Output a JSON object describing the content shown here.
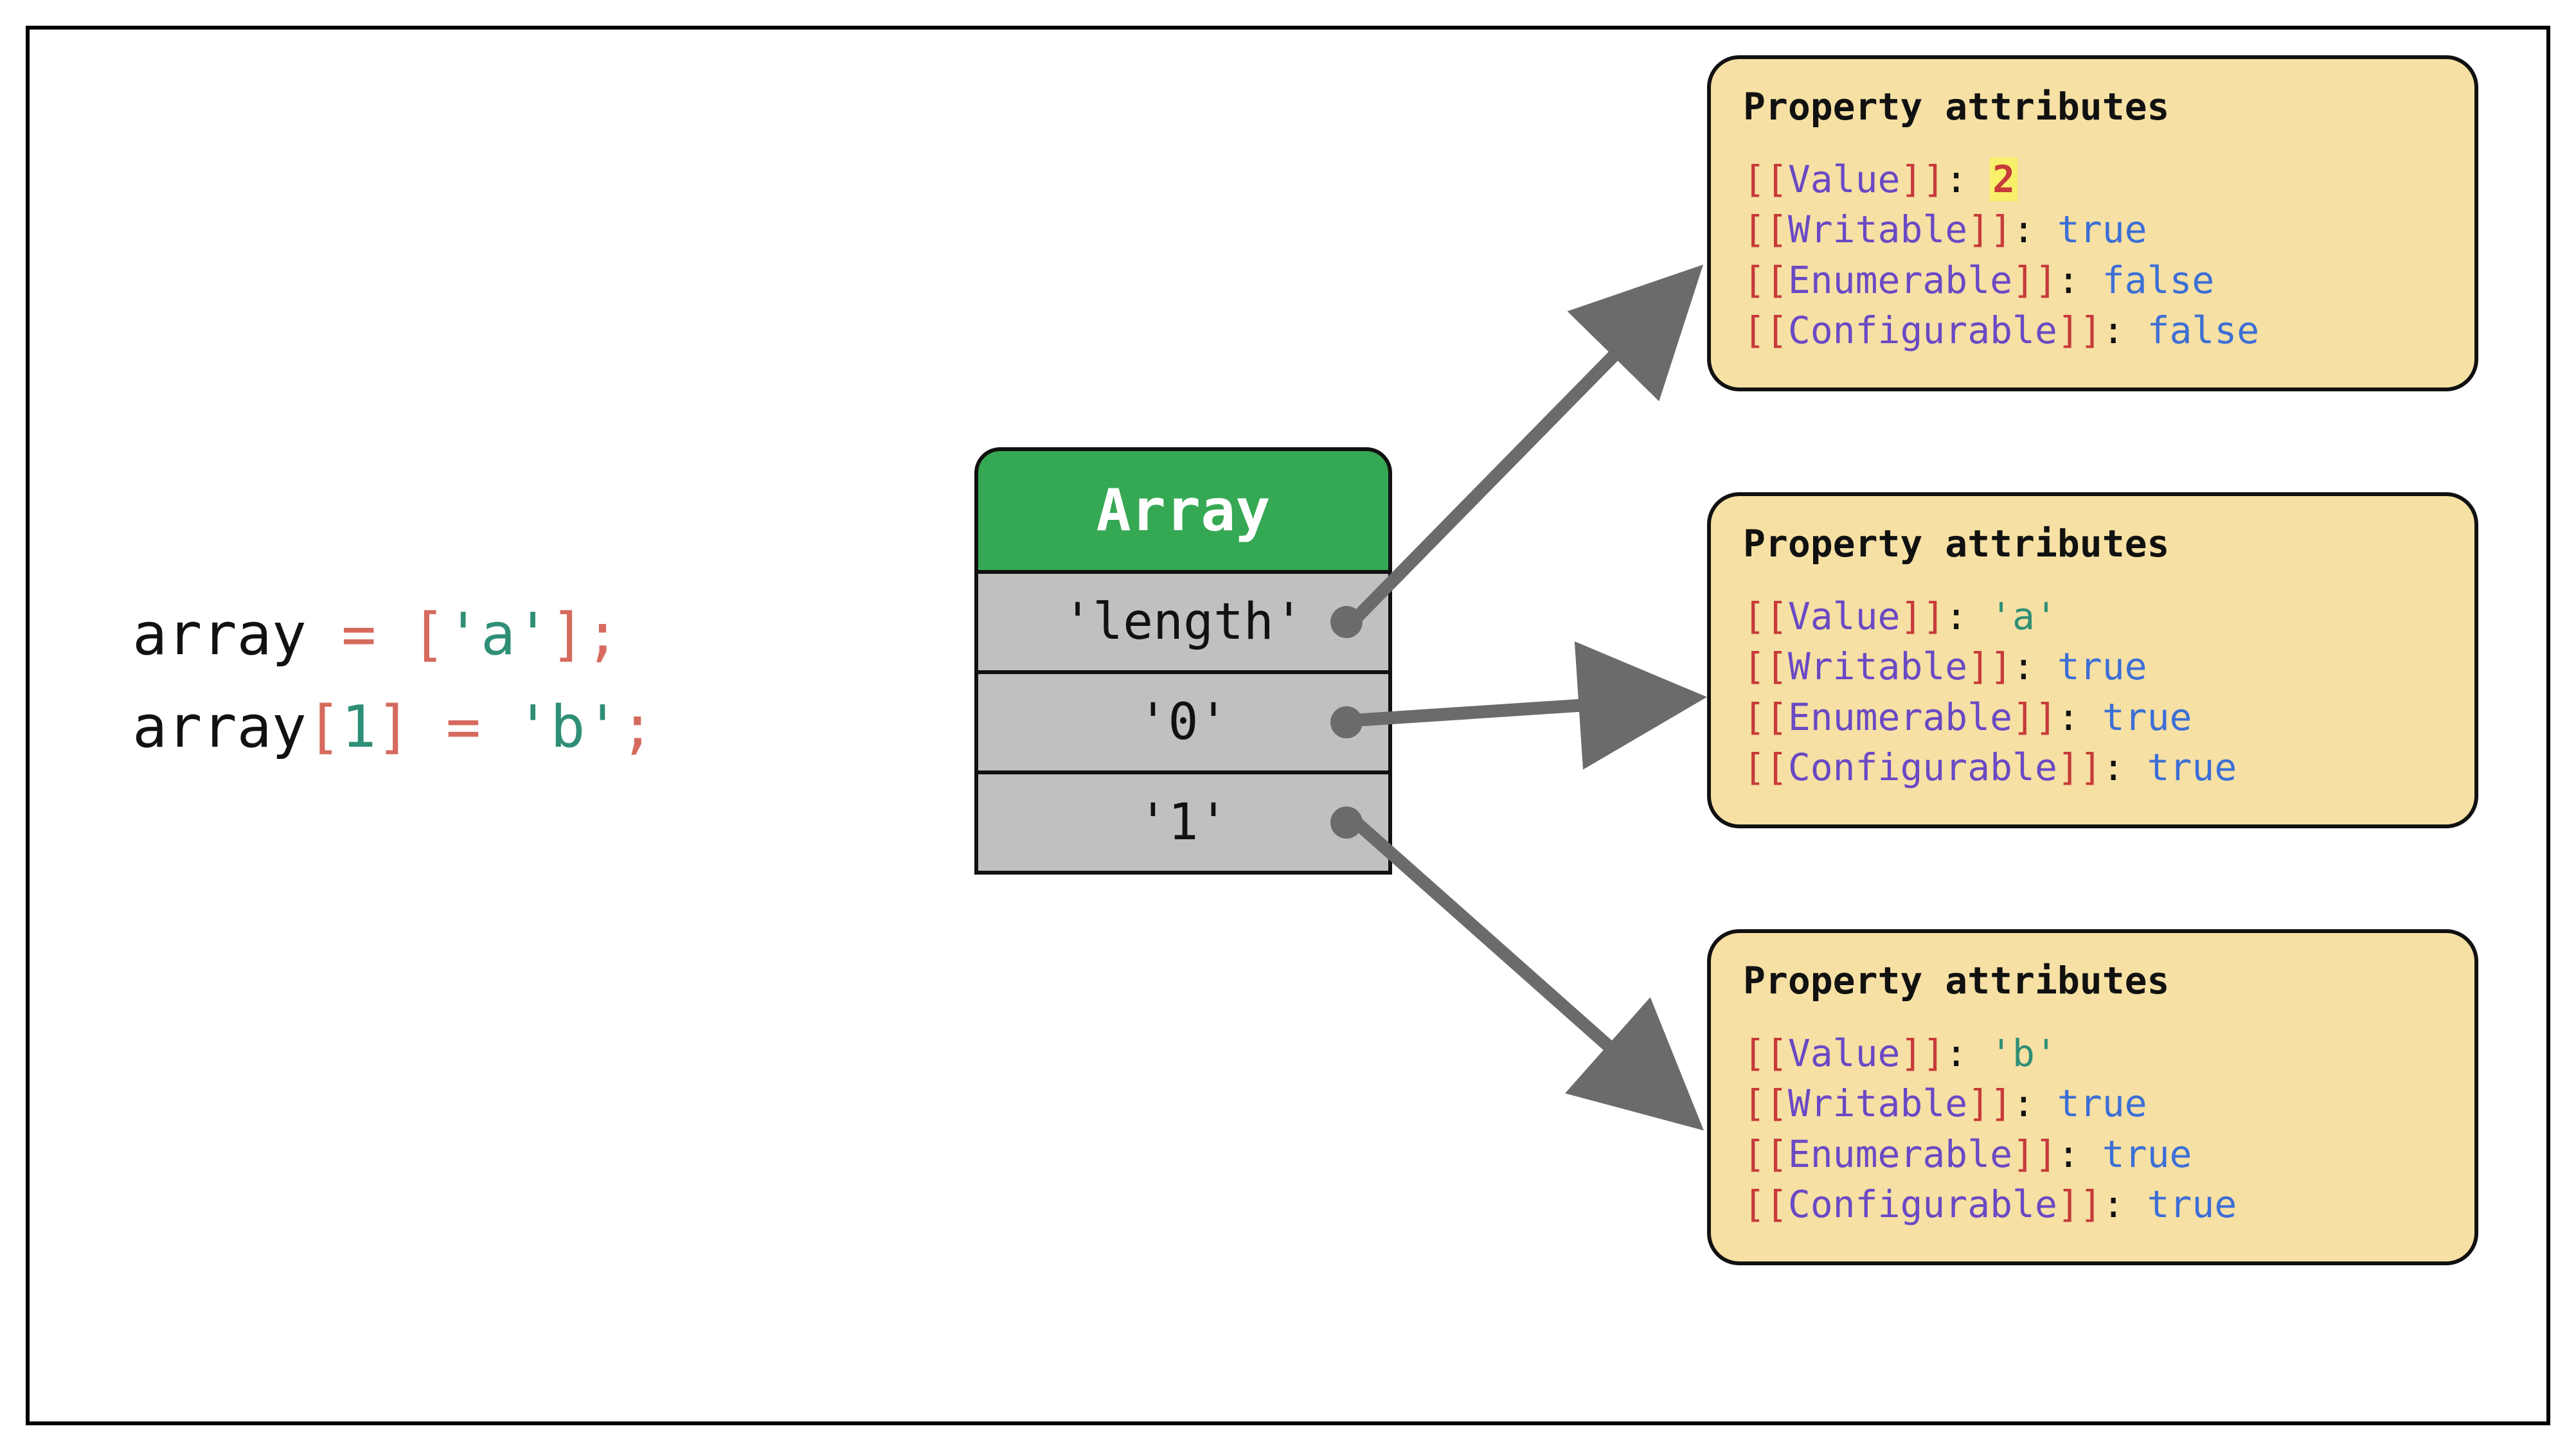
{
  "code": {
    "line1": {
      "t1": "array ",
      "t2": "= [",
      "t3": "'a'",
      "t4": "];"
    },
    "line2": {
      "t1": "array",
      "t2": "[",
      "t3": "1",
      "t4": "] ",
      "t5": "= ",
      "t6": "'b'",
      "t7": ";"
    }
  },
  "array_box": {
    "header": "Array",
    "cells": [
      "'length'",
      "'0'",
      "'1'"
    ]
  },
  "cards": [
    {
      "title": "Property attributes",
      "lines": [
        {
          "attr": "Value",
          "value": "2",
          "value_class": "val-hl"
        },
        {
          "attr": "Writable",
          "value": "true",
          "value_class": "val-blue"
        },
        {
          "attr": "Enumerable",
          "value": "false",
          "value_class": "val-blue"
        },
        {
          "attr": "Configurable",
          "value": "false",
          "value_class": "val-blue"
        }
      ]
    },
    {
      "title": "Property attributes",
      "lines": [
        {
          "attr": "Value",
          "value": "'a'",
          "value_class": "val-green"
        },
        {
          "attr": "Writable",
          "value": "true",
          "value_class": "val-blue"
        },
        {
          "attr": "Enumerable",
          "value": "true",
          "value_class": "val-blue"
        },
        {
          "attr": "Configurable",
          "value": "true",
          "value_class": "val-blue"
        }
      ]
    },
    {
      "title": "Property attributes",
      "lines": [
        {
          "attr": "Value",
          "value": "'b'",
          "value_class": "val-green"
        },
        {
          "attr": "Writable",
          "value": "true",
          "value_class": "val-blue"
        },
        {
          "attr": "Enumerable",
          "value": "true",
          "value_class": "val-blue"
        },
        {
          "attr": "Configurable",
          "value": "true",
          "value_class": "val-blue"
        }
      ]
    }
  ]
}
